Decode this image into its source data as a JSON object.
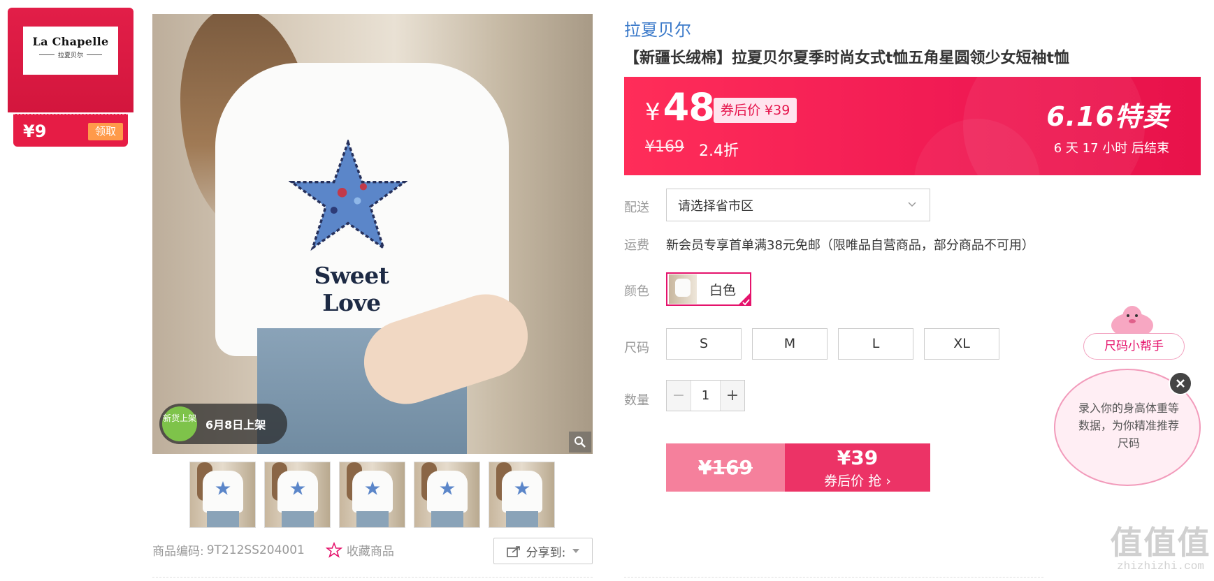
{
  "coupon": {
    "brand_en": "La Chapelle",
    "brand_cn": "拉夏贝尔",
    "amount": "¥9",
    "claim_label": "领取"
  },
  "gallery": {
    "print_text": "Sweet Love",
    "new_badge_label": "新货上架",
    "new_badge_date": "6月8日上架",
    "thumbnail_count": 5
  },
  "meta": {
    "sku_label": "商品编码:",
    "sku_value": "9T212SS204001",
    "favorite_label": "收藏商品",
    "share_label": "分享到:"
  },
  "product": {
    "brand_link": "拉夏贝尔",
    "title": "【新疆长绒棉】拉夏贝尔夏季时尚女式t恤五角星圆领少女短袖t恤"
  },
  "price": {
    "currency": "¥",
    "current": "48",
    "coupon_price_label": "券后价 ¥39",
    "original": "¥169",
    "discount": "2.4折",
    "promo_title": "6.16特卖",
    "countdown": "6 天 17 小时 后结束"
  },
  "delivery": {
    "label": "配送",
    "placeholder_value": "请选择省市区"
  },
  "shipping": {
    "label": "运费",
    "text": "新会员专享首单满38元免邮（限唯品自营商品，部分商品不可用）"
  },
  "color": {
    "label": "颜色",
    "options": [
      {
        "label": "白色",
        "selected": true
      }
    ]
  },
  "size": {
    "label": "尺码",
    "options": [
      "S",
      "M",
      "L",
      "XL"
    ]
  },
  "quantity": {
    "label": "数量",
    "value": "1",
    "minus": "−",
    "plus": "+"
  },
  "buy": {
    "original_price": "¥169",
    "coupon_price": "¥39",
    "coupon_action": "券后价 抢 ›"
  },
  "size_helper": {
    "button_label": "尺码小帮手",
    "bubble_text": "录入你的身高体重等数据，为你精准推荐尺码"
  },
  "watermark": {
    "big": "值值值",
    "small": "zhizhizhi.com"
  },
  "colors": {
    "accent": "#e5136c",
    "price_panel": "#f11b54",
    "brand_link": "#3a79c9",
    "coupon_red": "#e21e48"
  }
}
